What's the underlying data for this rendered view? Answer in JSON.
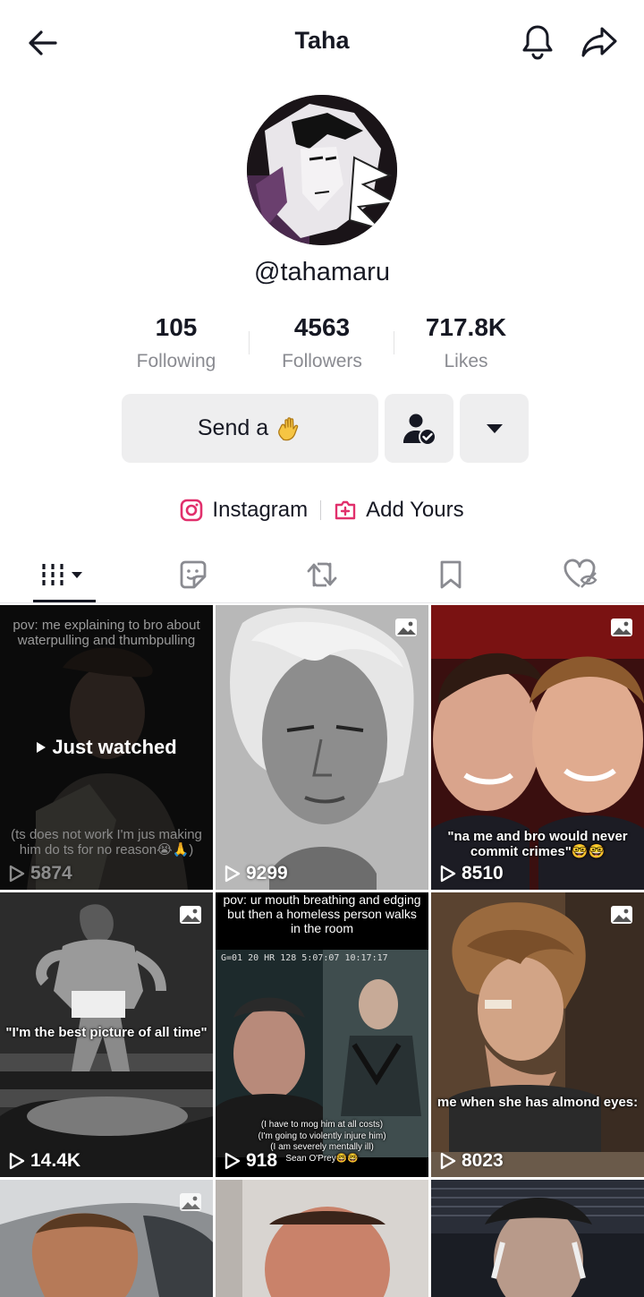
{
  "header": {
    "title": "Taha"
  },
  "profile": {
    "username": "@tahamaru",
    "stats": [
      {
        "value": "105",
        "label": "Following"
      },
      {
        "value": "4563",
        "label": "Followers"
      },
      {
        "value": "717.8K",
        "label": "Likes"
      }
    ],
    "send_button_label": "Send a",
    "links": [
      {
        "label": "Instagram",
        "icon": "instagram-icon",
        "color": "#e1306c"
      },
      {
        "label": "Add Yours",
        "icon": "add-yours-icon",
        "color": "#e1306c"
      }
    ]
  },
  "tabs": [
    {
      "name": "videos",
      "icon": "grid-icon"
    },
    {
      "name": "favorites",
      "icon": "sticker-icon"
    },
    {
      "name": "reposts",
      "icon": "repost-icon"
    },
    {
      "name": "saved",
      "icon": "bookmark-icon"
    },
    {
      "name": "liked",
      "icon": "hidden-heart-icon"
    }
  ],
  "videos": [
    {
      "views": "5874",
      "top_caption": "pov: me explaining to bro about waterpulling and thumbpulling",
      "bottom_caption": "(ts does not work I'm jus making him do ts for no reason😭🙏)",
      "overlay": "Just watched",
      "type": "video"
    },
    {
      "views": "9299",
      "type": "photo"
    },
    {
      "views": "8510",
      "bottom_caption": "\"na me and bro would never commit crimes\"🤓🤓",
      "type": "photo"
    },
    {
      "views": "14.4K",
      "mid_caption": "\"I'm the best picture of all time\"",
      "type": "photo"
    },
    {
      "views": "918",
      "top_caption": "pov: ur mouth breathing and edging but then a homeless person walks in the room",
      "hud": "G=01 20 HR 128    5:07:07 10:17:17",
      "bottom_caption": "(I have to mog him at all costs)\n(I'm going to violently injure him)\n(I am severely mentally ill)\nSean O'Prey🤓🤓",
      "type": "video"
    },
    {
      "views": "8023",
      "bottom_caption": "me when she has almond eyes:",
      "type": "photo"
    },
    {
      "views": "",
      "type": "photo"
    },
    {
      "views": "",
      "type": "video"
    },
    {
      "views": "",
      "type": "video"
    }
  ],
  "colors": {
    "text_primary": "#161823",
    "text_secondary": "#8a8b91",
    "button_bg": "#eeeeef",
    "accent": "#e1306c"
  }
}
